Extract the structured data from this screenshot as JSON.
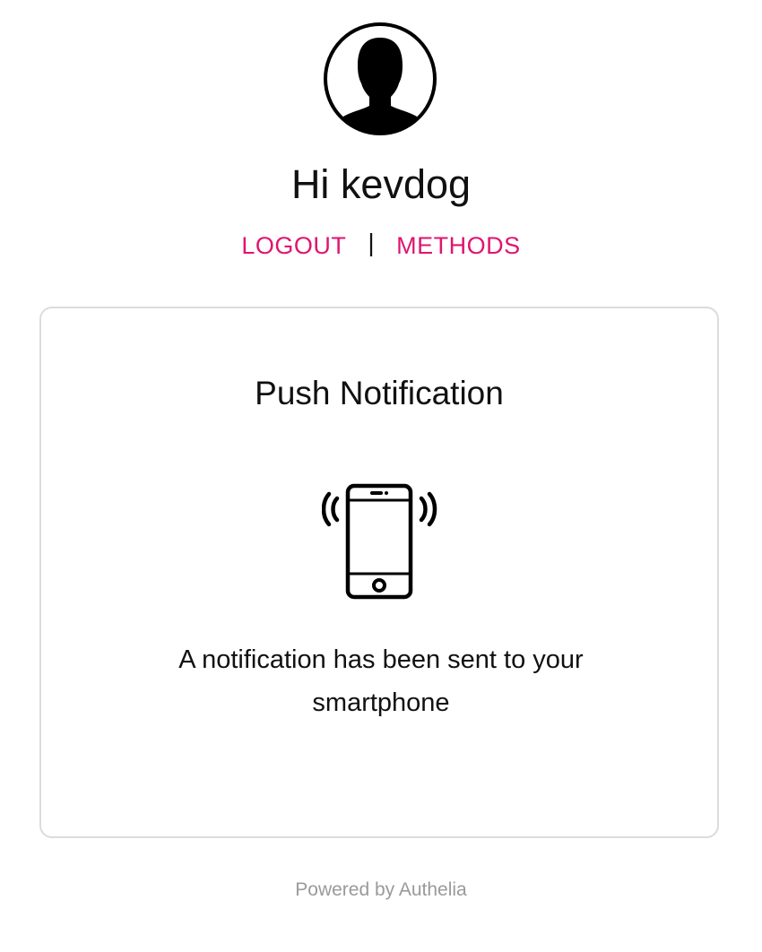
{
  "header": {
    "avatar_icon": "user-silhouette-icon",
    "greeting": "Hi kevdog"
  },
  "nav": {
    "logout_label": "LOGOUT",
    "separator": "|",
    "methods_label": "METHODS",
    "link_color": "#e0156f"
  },
  "card": {
    "title": "Push Notification",
    "icon": "vibrating-smartphone-icon",
    "message": "A notification has been sent to your smartphone"
  },
  "footer": {
    "text": "Powered by Authelia"
  }
}
